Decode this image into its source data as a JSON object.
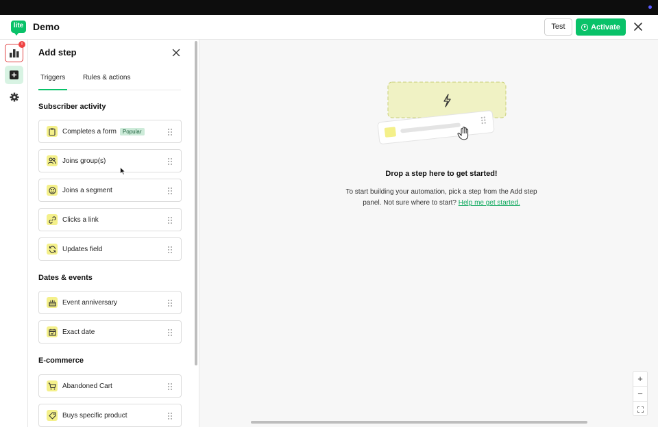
{
  "app": {
    "logo_text": "lite",
    "title": "Demo"
  },
  "header": {
    "test_label": "Test",
    "activate_label": "Activate"
  },
  "nav": {
    "reports_badge": "!"
  },
  "panel": {
    "title": "Add step",
    "tabs": [
      {
        "label": "Triggers",
        "active": true
      },
      {
        "label": "Rules & actions",
        "active": false
      }
    ],
    "sections": [
      {
        "title": "Subscriber activity",
        "items": [
          {
            "label": "Completes a form",
            "tag": "Popular",
            "icon": "clipboard-icon"
          },
          {
            "label": "Joins group(s)",
            "icon": "users-icon"
          },
          {
            "label": "Joins a segment",
            "icon": "segment-icon"
          },
          {
            "label": "Clicks a link",
            "icon": "link-icon"
          },
          {
            "label": "Updates field",
            "icon": "refresh-icon"
          }
        ]
      },
      {
        "title": "Dates & events",
        "items": [
          {
            "label": "Event anniversary",
            "icon": "cake-icon"
          },
          {
            "label": "Exact date",
            "icon": "calendar-check-icon"
          }
        ]
      },
      {
        "title": "E-commerce",
        "items": [
          {
            "label": "Abandoned Cart",
            "icon": "cart-icon"
          },
          {
            "label": "Buys specific product",
            "icon": "tag-icon"
          }
        ]
      }
    ]
  },
  "canvas": {
    "empty_title": "Drop a step here to get started!",
    "empty_text": "To start building your automation, pick a step from the Add step panel. Not sure where to start?",
    "help_link": "Help me get started.",
    "zoom_in": "+",
    "zoom_out": "−"
  },
  "colors": {
    "brand": "#09c269",
    "accent_yellow": "#f4f08a",
    "danger": "#ef4444"
  }
}
